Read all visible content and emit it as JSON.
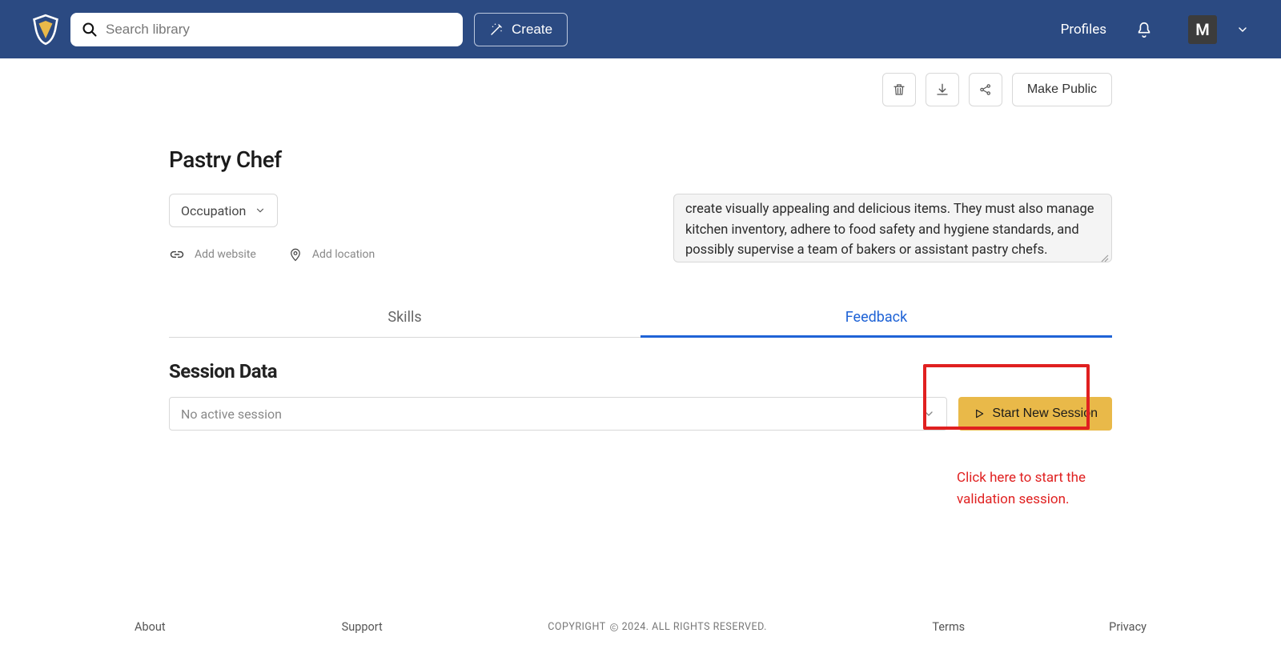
{
  "header": {
    "search_placeholder": "Search library",
    "create_label": "Create",
    "profiles_label": "Profiles",
    "avatar_initial": "M"
  },
  "actions": {
    "make_public_label": "Make Public"
  },
  "page": {
    "title": "Pastry Chef",
    "occupation_label": "Occupation",
    "add_website_label": "Add website",
    "add_location_label": "Add location",
    "description": "create visually appealing and delicious items. They must also manage kitchen inventory, adhere to food safety and hygiene standards, and possibly supervise a team of bakers or assistant pastry chefs."
  },
  "tabs": [
    {
      "label": "Skills",
      "active": false
    },
    {
      "label": "Feedback",
      "active": true
    }
  ],
  "session": {
    "section_title": "Session Data",
    "placeholder": "No active session",
    "start_label": "Start New Session"
  },
  "annotation": {
    "text": "Click here to start the validation session."
  },
  "footer": {
    "about": "About",
    "support": "Support",
    "copyright_prefix": "COPYRIGHT",
    "copyright_year": "2024. ALL RIGHTS RESERVED.",
    "terms": "Terms",
    "privacy": "Privacy"
  }
}
